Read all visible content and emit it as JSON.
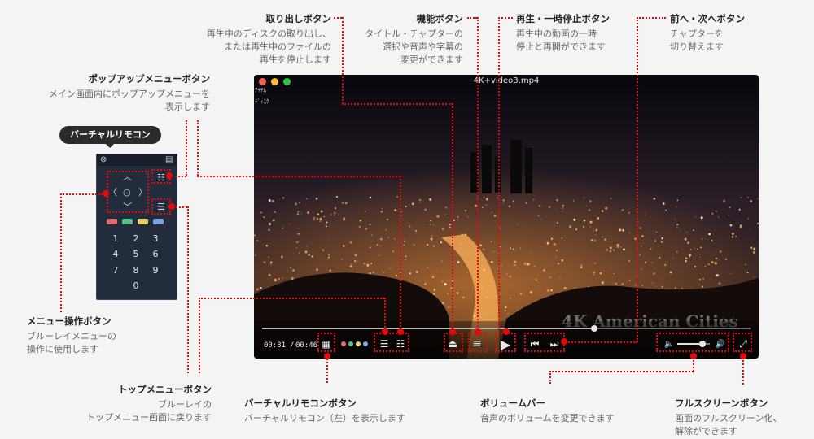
{
  "player": {
    "title": "4K+video3.mp4",
    "corner_label": "ｱｲﾃﾑ",
    "corner_label2": "ﾃﾞｨｽｸ",
    "video_caption": "4K American Cities",
    "elapsed": "00:31",
    "duration": "00:46",
    "progress_fraction": 0.68,
    "volume_fraction": 0.78
  },
  "remote": {
    "badge": "バーチャルリモコン",
    "keys": [
      "1",
      "2",
      "3",
      "4",
      "5",
      "6",
      "7",
      "8",
      "9",
      "0"
    ],
    "color_keys": [
      "#e06a70",
      "#54c08a",
      "#e2d060",
      "#7da4e0"
    ]
  },
  "annotations": {
    "eject": {
      "title": "取り出しボタン",
      "desc": "再生中のディスクの取り出し、\nまたは再生中のファイルの\n再生を停止します"
    },
    "function": {
      "title": "機能ボタン",
      "desc": "タイトル・チャプターの\n選択や音声や字幕の\n変更ができます"
    },
    "play": {
      "title": "再生・一時停止ボタン",
      "desc": "再生中の動画の一時\n停止と再開ができます"
    },
    "prevnext": {
      "title": "前へ・次へボタン",
      "desc": "チャプターを\n切り替えます"
    },
    "popup": {
      "title": "ポップアップメニューボタン",
      "desc": "メイン画面内にポップアップメニューを\n表示します"
    },
    "menu_op": {
      "title": "メニュー操作ボタン",
      "desc": "ブルーレイメニューの\n操作に使用します"
    },
    "top_menu": {
      "title": "トップメニューボタン",
      "desc": "ブルーレイの\nトップメニュー画面に戻ります"
    },
    "remote_btn": {
      "title": "バーチャルリモコンボタン",
      "desc": "バーチャルリモコン（左）を表示します"
    },
    "volume": {
      "title": "ボリュームバー",
      "desc": "音声のボリュームを変更できます"
    },
    "fullscreen": {
      "title": "フルスクリーンボタン",
      "desc": "画面のフルスクリーン化、\n解除ができます"
    }
  },
  "colors": {
    "accent": "#e20b0b",
    "player_bg": "#120e12",
    "remote_bg": "#232c3d"
  },
  "icons": [
    "close-icon",
    "menu-icon",
    "up-icon",
    "down-icon",
    "left-icon",
    "right-icon",
    "ok-icon",
    "popup-menu-icon",
    "top-menu-icon",
    "remote-icon",
    "eject-icon",
    "hamburger-icon",
    "play-icon",
    "prev-icon",
    "next-icon",
    "volume-low-icon",
    "volume-high-icon",
    "fullscreen-icon"
  ]
}
